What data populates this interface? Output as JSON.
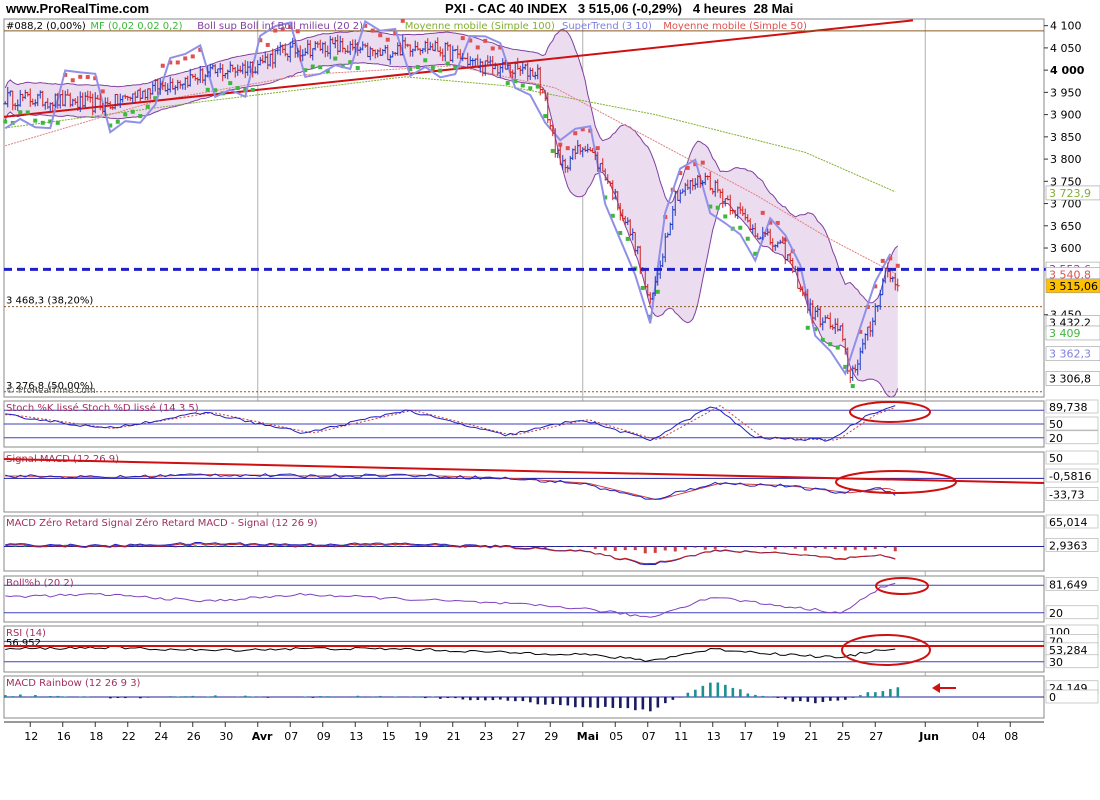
{
  "header": {
    "site": "www.ProRealTime.com",
    "title": "PXI - CAC 40 INDEX   3 515,06 (-0,29%)   4 heures  28 Mai"
  },
  "colors": {
    "bull_bar": "#1a3cc8",
    "bear_bar": "#d22020",
    "supertrend_up": "#3cb83c",
    "supertrend_down": "#e05050",
    "bollinger": "#8040a0",
    "bollinger_fill": "#ecdcf0",
    "ma100": "#80b030",
    "ma50": "#e08080",
    "level_line": "#2020c8",
    "annotation": "#d01010"
  },
  "price_panel": {
    "legend": [
      {
        "text": "#088,2 (0,00%)",
        "color": "#000000"
      },
      {
        "text": "MF (0,02 0,02 0,2)",
        "color": "#3cb83c"
      },
      {
        "text": "Boll sup Boll inf Boll milieu (20 2)",
        "color": "#8040a0"
      },
      {
        "text": "Moyenne mobile (Simple 100)",
        "color": "#80b030"
      },
      {
        "text": "SuperTrend (3 10)",
        "color": "#8080e0"
      },
      {
        "text": "Moyenne mobile (Simple 50)",
        "color": "#e05050"
      }
    ],
    "ylim": [
      3265,
      4115
    ],
    "yticks": [
      {
        "v": 4100,
        "t": "4 100"
      },
      {
        "v": 4050,
        "t": "4 050"
      },
      {
        "v": 4000,
        "t": "4 000"
      },
      {
        "v": 3950,
        "t": "3 950"
      },
      {
        "v": 3900,
        "t": "3 900"
      },
      {
        "v": 3850,
        "t": "3 850"
      },
      {
        "v": 3800,
        "t": "3 800"
      },
      {
        "v": 3750,
        "t": "3 750"
      },
      {
        "v": 3700,
        "t": "3 700"
      },
      {
        "v": 3650,
        "t": "3 650"
      },
      {
        "v": 3600,
        "t": "3 600"
      },
      {
        "v": 3450,
        "t": "3 450"
      }
    ],
    "value_labels": [
      {
        "v": 3723.9,
        "t": "3 723,9",
        "color": "#80b030",
        "bg": "#ffffff"
      },
      {
        "v": 3552.6,
        "t": "3 552,6",
        "color": "#8040a0",
        "bg": "#ffffff"
      },
      {
        "v": 3540.8,
        "t": "3 540,8",
        "color": "#e05050",
        "bg": "#ffffff"
      },
      {
        "v": 3515.06,
        "t": "3 515,06",
        "color": "#000000",
        "bg": "#ffc000"
      },
      {
        "v": 3432.2,
        "t": "3 432,2",
        "color": "#000000",
        "bg": "#ffffff"
      },
      {
        "v": 3409,
        "t": "3 409",
        "color": "#3cb83c",
        "bg": "#ffffff"
      },
      {
        "v": 3362.3,
        "t": "3 362,3",
        "color": "#8080e0",
        "bg": "#ffffff"
      },
      {
        "v": 3306.8,
        "t": "3 306,8",
        "color": "#000000",
        "bg": "#ffffff"
      }
    ],
    "fib_levels": [
      {
        "v": 3468.3,
        "label": "3 468,3 (38,20%)"
      },
      {
        "v": 3276.8,
        "label": "3 276,8 (50,00%)"
      }
    ],
    "blue_level": 3552,
    "top_level": 4088.2,
    "watermark": "© ProRealTime.com"
  },
  "sub_panels": [
    {
      "id": "stoch",
      "legend": "Stoch %K lissé Stoch %D lissé (14 3 5)",
      "ylim": [
        0,
        100
      ],
      "levels": [
        80,
        50,
        20
      ],
      "labels": [
        {
          "v": 89.738,
          "t": "89,738"
        },
        {
          "v": 50,
          "t": "50"
        },
        {
          "v": 20,
          "t": "20"
        }
      ]
    },
    {
      "id": "macd",
      "legend": "Signal MACD (12 26 9)",
      "ylim": [
        -70,
        55
      ],
      "levels": [
        0
      ],
      "labels": [
        {
          "v": 50,
          "t": "50"
        },
        {
          "v": 5,
          "t": "-0,5816"
        },
        {
          "v": -33.73,
          "t": "-33,73"
        }
      ]
    },
    {
      "id": "macdzr",
      "legend": "MACD Zéro Retard Signal Zéro Retard MACD - Signal (12 26 9)",
      "ylim": [
        -60,
        75
      ],
      "levels": [
        0
      ],
      "labels": [
        {
          "v": 65.014,
          "t": "65,014"
        },
        {
          "v": 2.9363,
          "t": "2,9363"
        }
      ]
    },
    {
      "id": "bollb",
      "legend": "Boll%b (20 2)",
      "ylim": [
        0,
        100
      ],
      "levels": [
        80,
        20
      ],
      "labels": [
        {
          "v": 81.649,
          "t": "81,649"
        },
        {
          "v": 20,
          "t": "20"
        }
      ]
    },
    {
      "id": "rsi",
      "legend": "RSI (14)",
      "ylim": [
        10,
        100
      ],
      "levels": [
        70,
        30
      ],
      "labels": [
        {
          "v": 100,
          "t": "100"
        },
        {
          "v": 70,
          "t": "70"
        },
        {
          "v": 53.284,
          "t": "53,284"
        },
        {
          "v": 30,
          "t": "30"
        }
      ],
      "extra_label": "56,952"
    },
    {
      "id": "rainbow",
      "legend": "MACD Rainbow (12 26 9 3)",
      "ylim": [
        -55,
        55
      ],
      "levels": [
        0
      ],
      "labels": [
        {
          "v": 24.149,
          "t": "24,149"
        },
        {
          "v": 0,
          "t": "0"
        }
      ]
    }
  ],
  "x_axis": {
    "ticks": [
      {
        "i": 10,
        "t": "12"
      },
      {
        "i": 23,
        "t": "16"
      },
      {
        "i": 36,
        "t": "18"
      },
      {
        "i": 49,
        "t": "22"
      },
      {
        "i": 62,
        "t": "24"
      },
      {
        "i": 75,
        "t": "26"
      },
      {
        "i": 88,
        "t": "30"
      },
      {
        "i": 101,
        "t": "Avr",
        "bold": true
      },
      {
        "i": 114,
        "t": "07"
      },
      {
        "i": 127,
        "t": "09"
      },
      {
        "i": 140,
        "t": "13"
      },
      {
        "i": 153,
        "t": "15"
      },
      {
        "i": 166,
        "t": "19"
      },
      {
        "i": 179,
        "t": "21"
      },
      {
        "i": 192,
        "t": "23"
      },
      {
        "i": 205,
        "t": "27"
      },
      {
        "i": 218,
        "t": "29"
      },
      {
        "i": 231,
        "t": "Mai",
        "bold": true
      },
      {
        "i": 244,
        "t": "05"
      },
      {
        "i": 257,
        "t": "07"
      },
      {
        "i": 270,
        "t": "11"
      },
      {
        "i": 283,
        "t": "13"
      },
      {
        "i": 296,
        "t": "17"
      },
      {
        "i": 309,
        "t": "19"
      },
      {
        "i": 322,
        "t": "21"
      },
      {
        "i": 335,
        "t": "25"
      },
      {
        "i": 348,
        "t": "27"
      },
      {
        "i": 368,
        "t": "Jun",
        "bold": true
      },
      {
        "i": 389,
        "t": "04"
      },
      {
        "i": 402,
        "t": "08"
      }
    ],
    "month_separators": [
      101,
      231,
      368
    ]
  },
  "chart_data": {
    "type": "ohlc",
    "title": "PXI - CAC 40 INDEX",
    "timeframe": "4 heures",
    "last_date": "28 Mai",
    "last_close": 3515.06,
    "change_pct": -0.29,
    "bar_count": 358,
    "close_path": [
      [
        0,
        3938
      ],
      [
        20,
        3932
      ],
      [
        40,
        3920
      ],
      [
        60,
        3962
      ],
      [
        80,
        3990
      ],
      [
        100,
        4012
      ],
      [
        110,
        4040
      ],
      [
        130,
        4055
      ],
      [
        150,
        4035
      ],
      [
        164,
        4060
      ],
      [
        175,
        4045
      ],
      [
        190,
        4010
      ],
      [
        205,
        4000
      ],
      [
        213,
        3995
      ],
      [
        222,
        3780
      ],
      [
        232,
        3835
      ],
      [
        240,
        3765
      ],
      [
        252,
        3610
      ],
      [
        258,
        3470
      ],
      [
        268,
        3720
      ],
      [
        280,
        3760
      ],
      [
        290,
        3700
      ],
      [
        300,
        3640
      ],
      [
        312,
        3590
      ],
      [
        322,
        3460
      ],
      [
        334,
        3410
      ],
      [
        338,
        3310
      ],
      [
        346,
        3420
      ],
      [
        352,
        3550
      ],
      [
        357,
        3515
      ]
    ],
    "series": [
      {
        "name": "Moyenne mobile (Simple 100)",
        "values": [
          [
            0,
            3870
          ],
          [
            80,
            3930
          ],
          [
            160,
            3985
          ],
          [
            200,
            3965
          ],
          [
            260,
            3900
          ],
          [
            320,
            3815
          ],
          [
            357,
            3724
          ]
        ]
      },
      {
        "name": "Moyenne mobile (Simple 50)",
        "values": [
          [
            0,
            3830
          ],
          [
            60,
            3930
          ],
          [
            120,
            3990
          ],
          [
            180,
            4010
          ],
          [
            220,
            3960
          ],
          [
            260,
            3840
          ],
          [
            300,
            3720
          ],
          [
            330,
            3620
          ],
          [
            357,
            3540
          ]
        ]
      },
      {
        "name": "Stoch %K lissé",
        "values": [
          [
            0,
            70
          ],
          [
            40,
            40
          ],
          [
            80,
            75
          ],
          [
            120,
            30
          ],
          [
            160,
            80
          ],
          [
            200,
            25
          ],
          [
            230,
            60
          ],
          [
            258,
            15
          ],
          [
            283,
            90
          ],
          [
            300,
            20
          ],
          [
            330,
            15
          ],
          [
            345,
            70
          ],
          [
            355,
            90
          ]
        ]
      },
      {
        "name": "Signal MACD",
        "values": [
          [
            0,
            5
          ],
          [
            40,
            2
          ],
          [
            80,
            8
          ],
          [
            120,
            5
          ],
          [
            160,
            7
          ],
          [
            200,
            0
          ],
          [
            230,
            -10
          ],
          [
            258,
            -45
          ],
          [
            283,
            -10
          ],
          [
            310,
            -15
          ],
          [
            335,
            -30
          ],
          [
            350,
            -20
          ],
          [
            357,
            -33.73
          ]
        ]
      },
      {
        "name": "Boll%b",
        "values": [
          [
            0,
            55
          ],
          [
            40,
            60
          ],
          [
            80,
            45
          ],
          [
            120,
            60
          ],
          [
            160,
            50
          ],
          [
            200,
            40
          ],
          [
            230,
            30
          ],
          [
            258,
            10
          ],
          [
            283,
            55
          ],
          [
            310,
            35
          ],
          [
            335,
            20
          ],
          [
            350,
            75
          ],
          [
            355,
            81.649
          ]
        ]
      },
      {
        "name": "RSI",
        "values": [
          [
            0,
            55
          ],
          [
            40,
            58
          ],
          [
            80,
            52
          ],
          [
            120,
            56
          ],
          [
            160,
            55
          ],
          [
            200,
            48
          ],
          [
            230,
            45
          ],
          [
            258,
            32
          ],
          [
            283,
            55
          ],
          [
            310,
            45
          ],
          [
            335,
            38
          ],
          [
            350,
            55
          ],
          [
            357,
            53.284
          ]
        ]
      },
      {
        "name": "MACD Rainbow",
        "values": [
          [
            0,
            5
          ],
          [
            40,
            -3
          ],
          [
            80,
            2
          ],
          [
            120,
            0
          ],
          [
            160,
            2
          ],
          [
            200,
            -10
          ],
          [
            230,
            -25
          ],
          [
            258,
            -35
          ],
          [
            283,
            40
          ],
          [
            300,
            5
          ],
          [
            320,
            -15
          ],
          [
            335,
            -10
          ],
          [
            345,
            10
          ],
          [
            357,
            24.149
          ]
        ]
      }
    ]
  }
}
